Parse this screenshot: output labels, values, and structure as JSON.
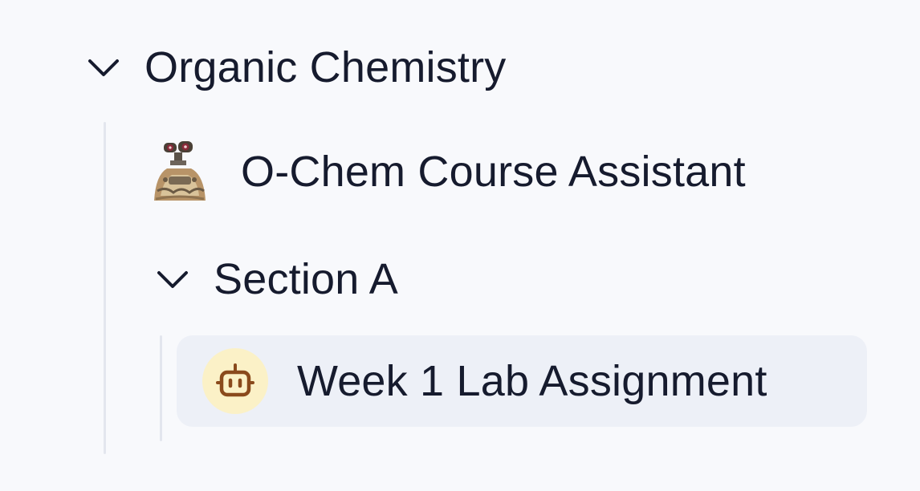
{
  "tree": {
    "course": {
      "label": "Organic Chemistry",
      "expanded": true,
      "icon": "chevron-down-icon"
    },
    "assistant": {
      "label": "O-Chem Course Assistant",
      "icon": "robot-avatar-image"
    },
    "section": {
      "label": "Section A",
      "expanded": true,
      "icon": "chevron-down-icon"
    },
    "assignment": {
      "label": "Week 1 Lab Assignment",
      "icon": "bot-icon",
      "selected": true
    }
  },
  "colors": {
    "background": "#f8f9fc",
    "text": "#161b2e",
    "selected_row": "#edf0f7",
    "guide_line": "#e3e6ee",
    "bot_badge_bg": "#fbf1c7",
    "bot_badge_fg": "#8a4a1c"
  }
}
